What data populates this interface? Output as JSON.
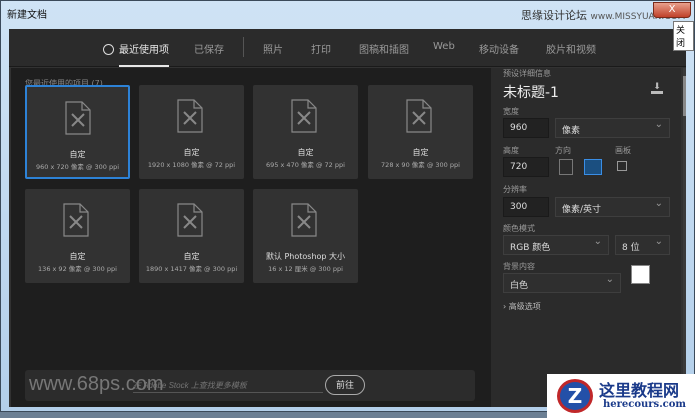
{
  "window": {
    "title": "新建文档",
    "close": "X",
    "close_tooltip": "关闭"
  },
  "watermarks": {
    "top": "思缘设计论坛",
    "top_url": "www.MISSYUAN.COM",
    "bottom_left": "www.68ps.com",
    "logo_cn": "这里教程网",
    "logo_url": "herecours.com",
    "logo_mark": "Z"
  },
  "tabs": [
    {
      "label": "最近使用项"
    },
    {
      "label": "已保存"
    },
    {
      "label": "照片"
    },
    {
      "label": "打印"
    },
    {
      "label": "图稿和插图"
    },
    {
      "label": "Web"
    },
    {
      "label": "移动设备"
    },
    {
      "label": "胶片和视频"
    }
  ],
  "recent": {
    "heading": "您最近使用的项目",
    "count": "(7)",
    "items": [
      {
        "name": "自定",
        "size": "960 x 720 像素 @ 300 ppi"
      },
      {
        "name": "自定",
        "size": "1920 x 1080 像素 @ 72 ppi"
      },
      {
        "name": "自定",
        "size": "695 x 470 像素 @ 72 ppi"
      },
      {
        "name": "自定",
        "size": "728 x 90 像素 @ 300 ppi"
      },
      {
        "name": "自定",
        "size": "136 x 92 像素 @ 300 ppi"
      },
      {
        "name": "自定",
        "size": "1890 x 1417 像素 @ 300 ppi"
      },
      {
        "name": "默认 Photoshop 大小",
        "size": "16 x 12 厘米 @ 300 ppi"
      }
    ]
  },
  "footer": {
    "search_placeholder": "在 Adobe Stock 上查找更多模板",
    "go": "前往"
  },
  "preset": {
    "heading": "预设详细信息",
    "doc_name": "未标题-1",
    "width_label": "宽度",
    "width": "960",
    "width_unit": "像素",
    "height_label": "高度",
    "height": "720",
    "orientation_label": "方向",
    "artboard_label": "画板",
    "resolution_label": "分辨率",
    "resolution": "300",
    "resolution_unit": "像素/英寸",
    "color_mode_label": "颜色模式",
    "color_mode": "RGB 颜色",
    "bit_depth": "8 位",
    "background_label": "背景内容",
    "background": "白色",
    "background_color": "#ffffff",
    "advanced": "高级选项"
  }
}
